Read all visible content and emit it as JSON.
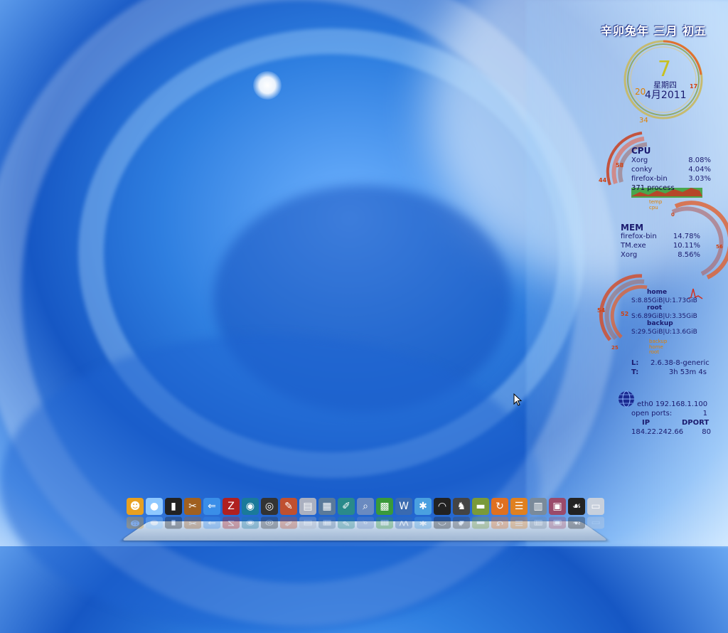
{
  "desktop": {
    "lunar_date": "辛卯兔年 三月 初五"
  },
  "clock": {
    "day": "7",
    "weekday": "星期四",
    "month_year": "4月2011",
    "num_left": "20",
    "num_right": "17",
    "num_bottom": "34"
  },
  "cpu": {
    "title": "CPU",
    "rows": [
      {
        "name": "Xorg",
        "value": "8.08%"
      },
      {
        "name": "conky",
        "value": "4.04%"
      },
      {
        "name": "firefox-bin",
        "value": "3.03%"
      }
    ],
    "processes": "371 process",
    "gauge_a": "58",
    "gauge_b": "44",
    "gauge_c": "0",
    "legend_temp": "temp",
    "legend_cpu": "cpu"
  },
  "mem": {
    "title": "MEM",
    "rows": [
      {
        "name": "firefox-bin",
        "value": "14.78%"
      },
      {
        "name": "TM.exe",
        "value": "10.11%"
      },
      {
        "name": "Xorg",
        "value": "8.56%"
      }
    ],
    "gauge": "56"
  },
  "disk": {
    "home_label": "home",
    "home_value": "S:8.85GiB|U:1.73GiB",
    "root_label": "root",
    "root_value": "S:6.89GiB|U:3.35GiB",
    "backup_label": "backup",
    "backup_value": "S:29.5GiB|U:13.6GiB",
    "gauge_a": "54",
    "gauge_b": "52",
    "gauge_c": "25",
    "legend_backup": "backup",
    "legend_home": "home",
    "legend_root": "root"
  },
  "system": {
    "kernel_label": "L:",
    "kernel_value": "2.6.38-8-generic",
    "uptime_label": "T:",
    "uptime_value": "3h 53m 4s"
  },
  "network": {
    "iface": "eth0 192.168.1.100",
    "ports_label": "open ports:",
    "ports_value": "1",
    "col_ip": "IP",
    "col_dport": "DPORT",
    "ip": "184.22.242.66",
    "dport": "80"
  },
  "dock_icons": [
    {
      "name": "pidgin-icon",
      "glyph": "☻",
      "color": "#e8a020"
    },
    {
      "name": "emesene-icon",
      "glyph": "●",
      "color": "#8ec8ff"
    },
    {
      "name": "terminal-icon",
      "glyph": "▮",
      "color": "#222222"
    },
    {
      "name": "tools-icon",
      "glyph": "✂",
      "color": "#a06020"
    },
    {
      "name": "arrow-app-icon",
      "glyph": "⇐",
      "color": "#3a8ee8"
    },
    {
      "name": "filezilla-icon",
      "glyph": "Z",
      "color": "#b02020"
    },
    {
      "name": "skype-like-icon",
      "glyph": "◉",
      "color": "#1a7a9a"
    },
    {
      "name": "camera-icon",
      "glyph": "◎",
      "color": "#333333"
    },
    {
      "name": "paint-icon",
      "glyph": "✎",
      "color": "#c05030"
    },
    {
      "name": "media-icon",
      "glyph": "▤",
      "color": "#aab0c0"
    },
    {
      "name": "printer-icon",
      "glyph": "▦",
      "color": "#5a7a9a"
    },
    {
      "name": "editor-icon",
      "glyph": "✐",
      "color": "#2a8a8a"
    },
    {
      "name": "search-doc-icon",
      "glyph": "⌕",
      "color": "#6a8ac0"
    },
    {
      "name": "spreadsheet-icon",
      "glyph": "▩",
      "color": "#3a9a3a"
    },
    {
      "name": "chart-app-icon",
      "glyph": "W",
      "color": "#3a6ab0"
    },
    {
      "name": "splash-icon",
      "glyph": "✱",
      "color": "#4aa0e0"
    },
    {
      "name": "wifi-icon",
      "glyph": "◠",
      "color": "#222222"
    },
    {
      "name": "gimp-icon",
      "glyph": "♞",
      "color": "#444444"
    },
    {
      "name": "book-icon",
      "glyph": "▬",
      "color": "#7a9a3a"
    },
    {
      "name": "refresh-icon",
      "glyph": "↻",
      "color": "#e07020"
    },
    {
      "name": "rss-icon",
      "glyph": "☰",
      "color": "#e08020"
    },
    {
      "name": "trash-icon",
      "glyph": "▥",
      "color": "#7a8a9a"
    },
    {
      "name": "photo-icon",
      "glyph": "▣",
      "color": "#9a4a6a"
    },
    {
      "name": "gnome-foot-icon",
      "glyph": "☙",
      "color": "#222222"
    },
    {
      "name": "folder-icon",
      "glyph": "▭",
      "color": "#c8d0dc"
    }
  ]
}
